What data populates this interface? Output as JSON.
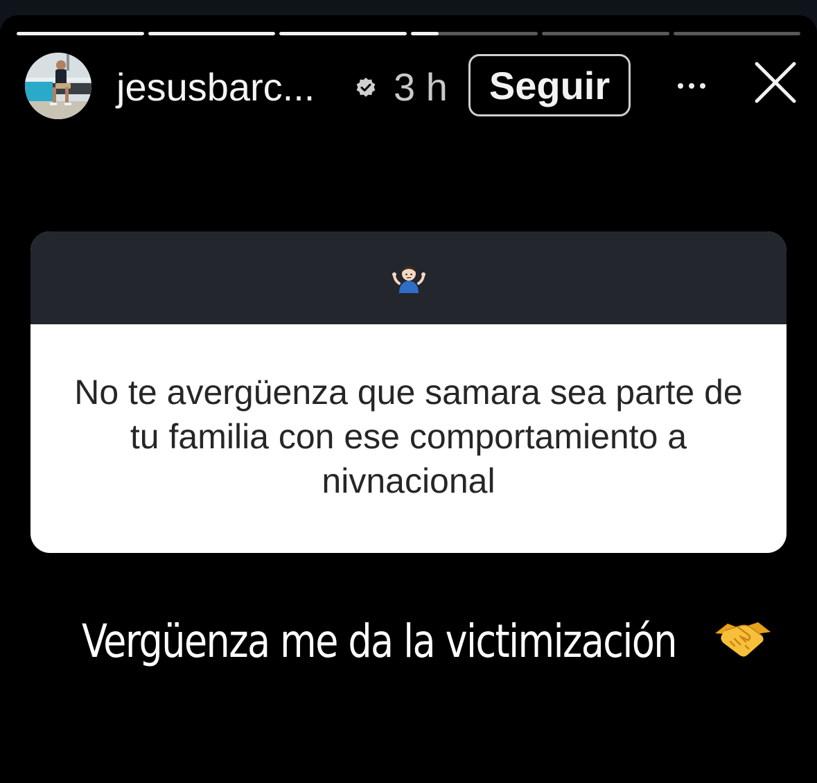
{
  "story": {
    "progress_segments": [
      {
        "fill": 1.0
      },
      {
        "fill": 1.0
      },
      {
        "fill": 1.0
      },
      {
        "fill": 0.22
      },
      {
        "fill": 0.0
      },
      {
        "fill": 0.0
      }
    ]
  },
  "header": {
    "avatar_icon": "profile-photo",
    "username": "jesusbarc...",
    "verified_icon": "verified-badge-icon",
    "time": "3 h",
    "follow_label": "Seguir",
    "more_icon": "more-icon",
    "close_icon": "close-icon"
  },
  "question_sticker": {
    "emoji_icon": "person-shrugging-emoji",
    "text": "No te avergüenza que samara sea parte de tu familia con ese comportamiento a nivnacional"
  },
  "answer": {
    "text": "Vergüenza me da la victimización",
    "emoji_icon": "handshake-emoji"
  },
  "colors": {
    "background": "#000000",
    "sticker_header": "#23262d",
    "sticker_body": "#ffffff",
    "text_primary": "#f4f4f4"
  }
}
